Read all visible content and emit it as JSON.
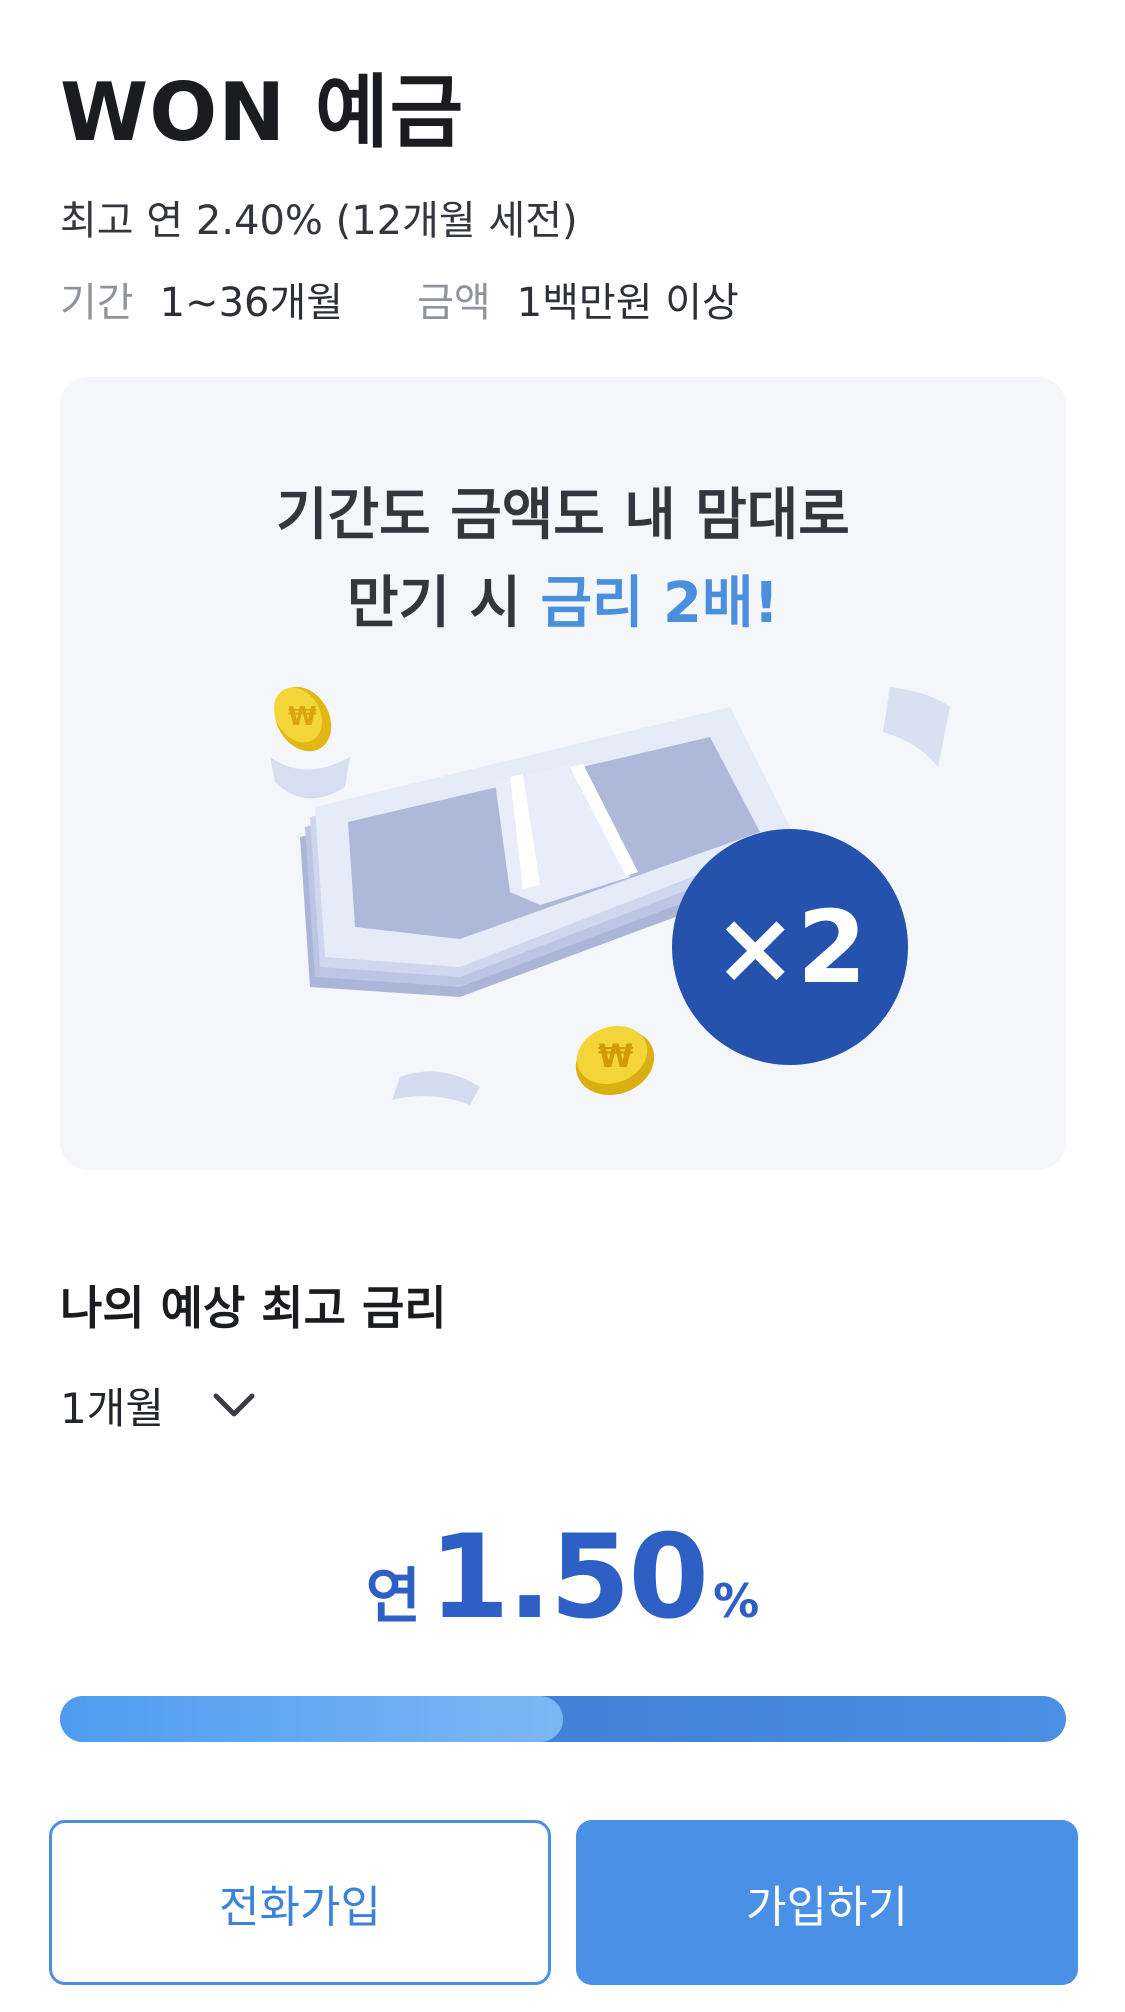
{
  "product": {
    "title": "WON 예금",
    "subtitle": "최고 연 2.40% (12개월 세전)",
    "term_label": "기간",
    "term_value": "1~36개월",
    "amount_label": "금액",
    "amount_value": "1백만원 이상"
  },
  "promo": {
    "line1": "기간도 금액도 내 맘대로",
    "line2_prefix": "만기 시",
    "line2_highlight": "금리 2배!",
    "badge_text": "×2",
    "colors": {
      "highlight": "#4a8fdd",
      "badge": "#2552ad",
      "card_bg": "#f4f6fa"
    }
  },
  "rate_section": {
    "heading": "나의 예상 최고 금리",
    "period_selected": "1개월",
    "rate_prefix": "연",
    "rate_value": "1.50",
    "rate_unit": "%",
    "progress_fraction": 0.5
  },
  "buttons": {
    "phone_join": "전화가입",
    "join": "가입하기"
  },
  "icons": {
    "period_toggle": "chevron-down-icon",
    "illustration": "money-stack-icon"
  }
}
